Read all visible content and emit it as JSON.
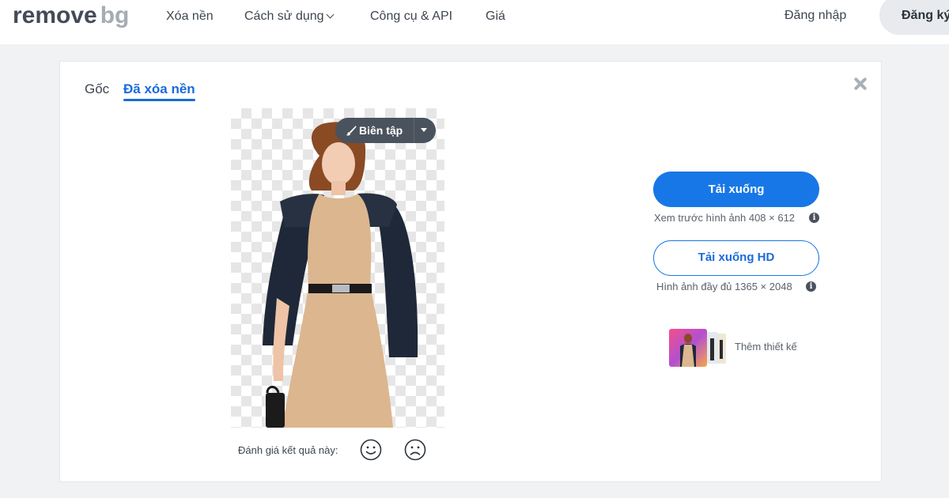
{
  "header": {
    "logo_main": "remove",
    "logo_accent": "bg",
    "nav": [
      {
        "label": "Xóa nền"
      },
      {
        "label": "Cách sử dụng"
      },
      {
        "label": "Công cụ & API"
      },
      {
        "label": "Giá"
      }
    ],
    "login_label": "Đăng nhập",
    "signup_label": "Đăng ký"
  },
  "result": {
    "tabs": [
      {
        "label": "Gốc",
        "active": false
      },
      {
        "label": "Đã xóa nền",
        "active": true
      }
    ],
    "edit_button_label": "Biên tập",
    "rating_label": "Đánh giá kết quả này:"
  },
  "actions": {
    "download_label": "Tải xuống",
    "preview_note": "Xem trước hình ảnh 408 × 612",
    "download_hd_label": "Tải xuống HD",
    "full_note": "Hình ảnh đầy đủ 1365 × 2048",
    "add_design_label": "Thêm thiết kế"
  },
  "colors": {
    "accent": "#1877e6",
    "tab_active": "#1a6bd9",
    "edit_button_bg": "#4a535d"
  },
  "icons": [
    "chevron-down-icon",
    "close-icon",
    "brush-icon",
    "caret-down-icon",
    "info-icon",
    "smile-icon",
    "frown-icon"
  ]
}
